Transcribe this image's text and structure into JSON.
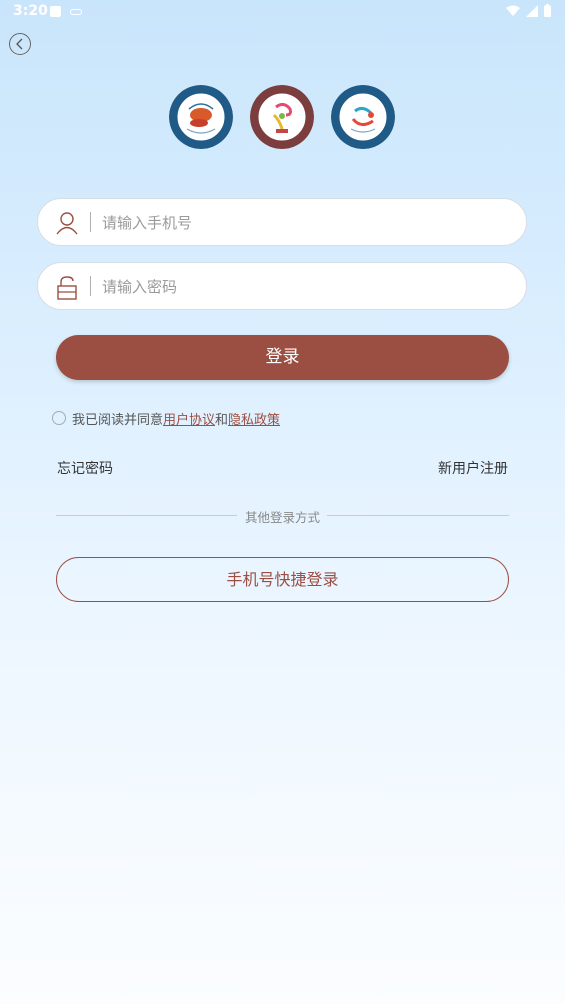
{
  "status_bar": {
    "time": "3:20"
  },
  "login": {
    "phone_placeholder": "请输入手机号",
    "password_placeholder": "请输入密码",
    "login_button": "登录",
    "agreement_prefix": "我已阅读并同意",
    "user_agreement": "用户协议",
    "agreement_and": "和",
    "privacy_policy": "隐私政策",
    "forgot_password": "忘记密码",
    "register": "新用户注册",
    "other_methods": "其他登录方式",
    "quick_login_button": "手机号快捷登录"
  },
  "colors": {
    "primary": "#9b4f42",
    "logo_blue": "#1f5b86",
    "logo_maroon": "#7b3d3d"
  },
  "icons": [
    "back-icon",
    "user-icon",
    "lock-icon",
    "wifi-icon",
    "signal-icon",
    "battery-icon"
  ]
}
